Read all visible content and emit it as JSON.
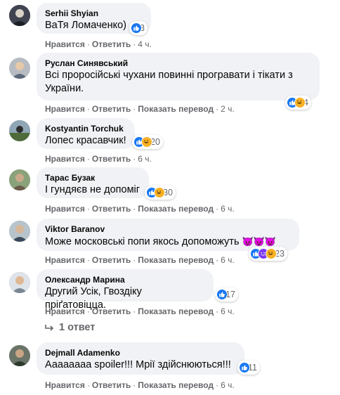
{
  "actions": {
    "like": "Нравится",
    "reply": "Ответить",
    "translate": "Показать перевод",
    "separator": "·"
  },
  "comments": [
    {
      "author": "Serhii Shyian",
      "text": "ВаТя Ломаченко)",
      "reactions": [
        "like"
      ],
      "count": "3",
      "time": "4 ч.",
      "translate": false
    },
    {
      "author": "Руслан Синявський",
      "text": "Всі проросійські чухани повинні програвати і тікати з України.",
      "reactions": [
        "like",
        "haha"
      ],
      "count": "4",
      "time": "2 ч.",
      "translate": true
    },
    {
      "author": "Kostyantin Torchuk",
      "text": "Лопес красавчик!",
      "reactions": [
        "like",
        "haha"
      ],
      "count": "20",
      "time": "6 ч.",
      "translate": false
    },
    {
      "author": "Тарас Бузак",
      "text": "І гундяєв не допоміг",
      "reactions": [
        "like",
        "haha"
      ],
      "count": "30",
      "time": "6 ч.",
      "translate": true
    },
    {
      "author": "Viktor Baranov",
      "text": "Може московські попи якось допоможуть",
      "emoji": "😈😈😈",
      "reactions": [
        "like",
        "devil",
        "haha"
      ],
      "count": "23",
      "time": "6 ч.",
      "translate": true
    },
    {
      "author": "Олександр Марина",
      "text": "Другий Усік, Гвоздіку пріґатовіцца.",
      "reactions": [
        "like"
      ],
      "count": "17",
      "time": "6 ч.",
      "translate": true
    },
    {
      "author": "Dejmall Adamenko",
      "text": "Аааааааа spoiler!!! Мрії здійснюються!!!",
      "reactions": [
        "like"
      ],
      "count": "11",
      "time": "6 ч.",
      "translate": true
    }
  ],
  "replies_link": "1 ответ",
  "colors": {
    "bubble": "#f0f2f5",
    "meta": "#65676b",
    "like": "#1877f2",
    "haha": "#f7b125",
    "devil": "#7c3aed"
  }
}
